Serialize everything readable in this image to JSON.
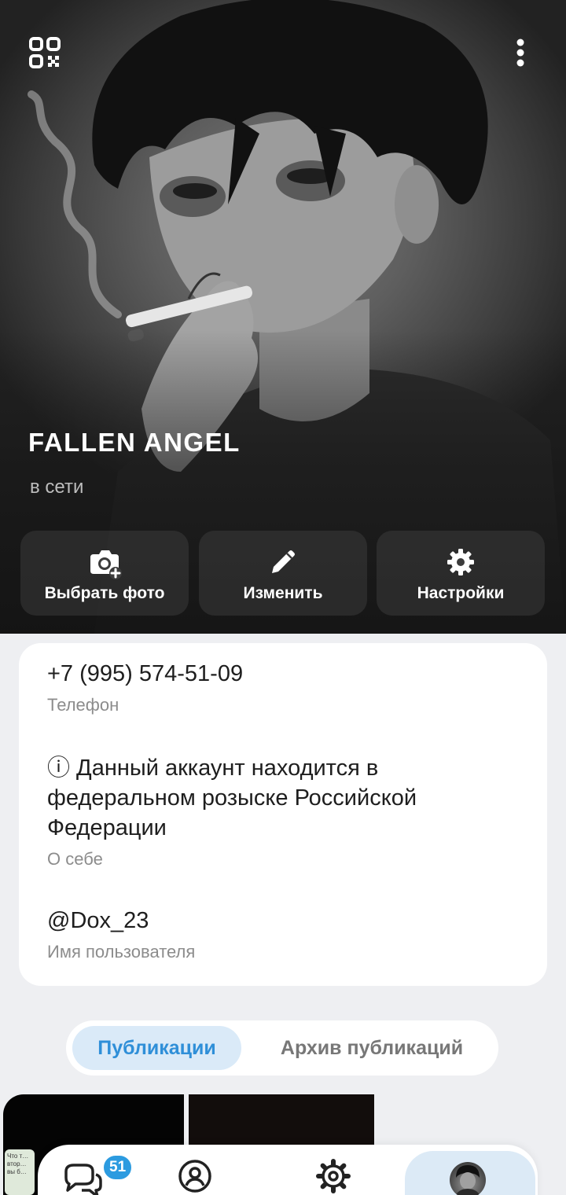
{
  "profile": {
    "name": "FALLEN ANGEL",
    "status": "в сети"
  },
  "actions": {
    "choose_photo": "Выбрать фото",
    "edit": "Изменить",
    "settings": "Настройки"
  },
  "info": {
    "phone_value": "+7 (995) 574-51-09",
    "phone_label": "Телефон",
    "about_value": "ⓘ Данный аккаунт находится в федеральном розыске Российской Федерации",
    "about_label": "О себе",
    "username_value": "@Dox_23",
    "username_label": "Имя пользователя"
  },
  "tabs": [
    {
      "label": "Публикации",
      "active": true
    },
    {
      "label": "Архив публикаций",
      "active": false
    }
  ],
  "nav": {
    "chats_badge": "51",
    "items": [
      "chats-icon",
      "contacts-icon",
      "settings-icon",
      "profile-avatar"
    ]
  },
  "peek_chat_text": "Что т… втор… вы б…",
  "colors": {
    "accent": "#2f8fd8",
    "badge": "#2c9be0",
    "tab_active_bg": "#daeaf8",
    "card_bg": "#ffffff",
    "page_bg": "#eeeff2"
  }
}
